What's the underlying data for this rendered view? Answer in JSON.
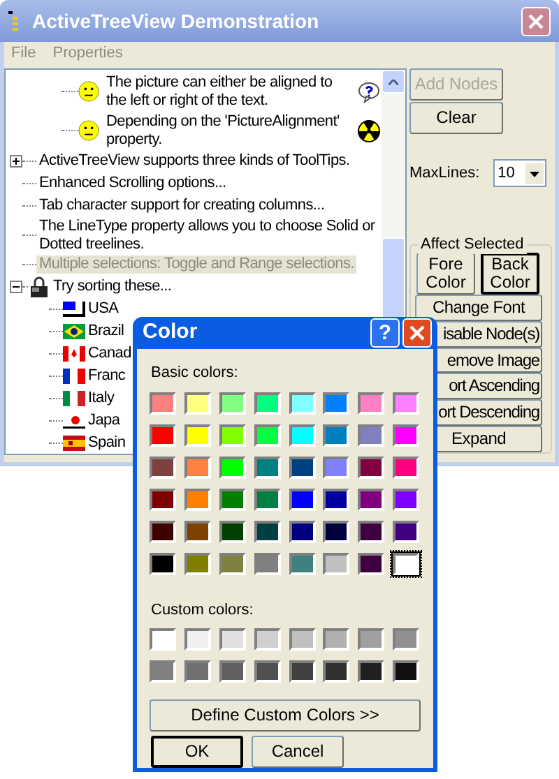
{
  "window": {
    "title": "ActiveTreeView Demonstration"
  },
  "menu": [
    "File",
    "Properties"
  ],
  "tree": {
    "continued_children": [
      {
        "kind": "note-question",
        "text": "The picture can either be aligned to the left or right of the text.",
        "selected": false
      },
      {
        "kind": "note-warning",
        "text": "Depending on the 'PictureAlignment' property.",
        "selected": false
      }
    ],
    "items": [
      {
        "kind": "plain",
        "text": "ActiveTreeView supports three kinds of ToolTips.",
        "expanded": false,
        "selected": false
      },
      {
        "kind": "plain",
        "text": "Enhanced Scrolling options...",
        "selected": false
      },
      {
        "kind": "plain",
        "text": "Tab character support for creating columns...",
        "selected": false
      },
      {
        "kind": "plain",
        "text": "The LineType property allows you to choose Solid or Dotted treelines.",
        "selected": false
      },
      {
        "kind": "plain",
        "text": "Multiple selections:  Toggle and Range selections.",
        "selected": true
      },
      {
        "kind": "lock",
        "text": "Try sorting these...",
        "expanded": true,
        "selected": false,
        "children": [
          {
            "kind": "flag",
            "text": "USA",
            "selected": false
          },
          {
            "kind": "flag",
            "text": "Brazil",
            "selected": false
          },
          {
            "kind": "flag",
            "text": "Canad",
            "selected": false
          },
          {
            "kind": "flag",
            "text": "Franc",
            "selected": false
          },
          {
            "kind": "flag",
            "text": "Italy",
            "selected": false
          },
          {
            "kind": "flag",
            "text": "Japa",
            "selected": false
          },
          {
            "kind": "flag",
            "text": "Spain",
            "selected": false
          }
        ]
      }
    ]
  },
  "side": {
    "buttons": [
      {
        "label": "Add Nodes",
        "disabled": true
      },
      {
        "label": "Clear",
        "disabled": false
      }
    ],
    "maxlines": {
      "label": "MaxLines:",
      "value": "10"
    },
    "group": {
      "title": "Affect Selected",
      "pair": [
        {
          "label": "Fore Color",
          "default": false
        },
        {
          "label": "Back Color",
          "default": true
        }
      ],
      "buttons": [
        {
          "label": "Change Font"
        },
        {
          "label": "isable Node(s)"
        },
        {
          "label": "emove Image"
        },
        {
          "label": "ort Ascending"
        },
        {
          "label": "ort Descending"
        },
        {
          "label": "Expand"
        }
      ]
    }
  },
  "dialog": {
    "title": "Color",
    "help": "?",
    "basic_label": "Basic colors:",
    "basic_colors": [
      {
        "color": "#ff8080",
        "selected": false
      },
      {
        "color": "#ffff80",
        "selected": false
      },
      {
        "color": "#80ff80",
        "selected": false
      },
      {
        "color": "#00ff80",
        "selected": false
      },
      {
        "color": "#80ffff",
        "selected": false
      },
      {
        "color": "#0080ff",
        "selected": false
      },
      {
        "color": "#ff80c0",
        "selected": false
      },
      {
        "color": "#ff80ff",
        "selected": false
      },
      {
        "color": "#ff0000",
        "selected": false
      },
      {
        "color": "#ffff00",
        "selected": false
      },
      {
        "color": "#80ff00",
        "selected": false
      },
      {
        "color": "#00ff40",
        "selected": false
      },
      {
        "color": "#00ffff",
        "selected": false
      },
      {
        "color": "#0080c0",
        "selected": false
      },
      {
        "color": "#8080c0",
        "selected": false
      },
      {
        "color": "#ff00ff",
        "selected": false
      },
      {
        "color": "#804040",
        "selected": false
      },
      {
        "color": "#ff8040",
        "selected": false
      },
      {
        "color": "#00ff00",
        "selected": false
      },
      {
        "color": "#008080",
        "selected": false
      },
      {
        "color": "#004080",
        "selected": false
      },
      {
        "color": "#8080ff",
        "selected": false
      },
      {
        "color": "#800040",
        "selected": false
      },
      {
        "color": "#ff0080",
        "selected": false
      },
      {
        "color": "#800000",
        "selected": false
      },
      {
        "color": "#ff8000",
        "selected": false
      },
      {
        "color": "#008000",
        "selected": false
      },
      {
        "color": "#008040",
        "selected": false
      },
      {
        "color": "#0000ff",
        "selected": false
      },
      {
        "color": "#0000a0",
        "selected": false
      },
      {
        "color": "#800080",
        "selected": false
      },
      {
        "color": "#8000ff",
        "selected": false
      },
      {
        "color": "#400000",
        "selected": false
      },
      {
        "color": "#804000",
        "selected": false
      },
      {
        "color": "#004000",
        "selected": false
      },
      {
        "color": "#004040",
        "selected": false
      },
      {
        "color": "#000080",
        "selected": false
      },
      {
        "color": "#000040",
        "selected": false
      },
      {
        "color": "#400040",
        "selected": false
      },
      {
        "color": "#400080",
        "selected": false
      },
      {
        "color": "#000000",
        "selected": false
      },
      {
        "color": "#808000",
        "selected": false
      },
      {
        "color": "#808040",
        "selected": false
      },
      {
        "color": "#808080",
        "selected": false
      },
      {
        "color": "#408080",
        "selected": false
      },
      {
        "color": "#c0c0c0",
        "selected": false
      },
      {
        "color": "#400040",
        "selected": false
      },
      {
        "color": "#ffffff",
        "selected": true
      }
    ],
    "custom_label": "Custom colors:",
    "custom_colors": [
      {
        "color": "#ffffff",
        "selected": false
      },
      {
        "color": "#f0f0f0",
        "selected": false
      },
      {
        "color": "#e0e0e0",
        "selected": false
      },
      {
        "color": "#d0d0d0",
        "selected": false
      },
      {
        "color": "#c0c0c0",
        "selected": false
      },
      {
        "color": "#b0b0b0",
        "selected": false
      },
      {
        "color": "#a0a0a0",
        "selected": false
      },
      {
        "color": "#909090",
        "selected": false
      },
      {
        "color": "#808080",
        "selected": false
      },
      {
        "color": "#707070",
        "selected": false
      },
      {
        "color": "#606060",
        "selected": false
      },
      {
        "color": "#505050",
        "selected": false
      },
      {
        "color": "#404040",
        "selected": false
      },
      {
        "color": "#303030",
        "selected": false
      },
      {
        "color": "#202020",
        "selected": false
      },
      {
        "color": "#101010",
        "selected": false
      }
    ],
    "define_button": "Define Custom Colors >>",
    "ok": "OK",
    "cancel": "Cancel"
  }
}
